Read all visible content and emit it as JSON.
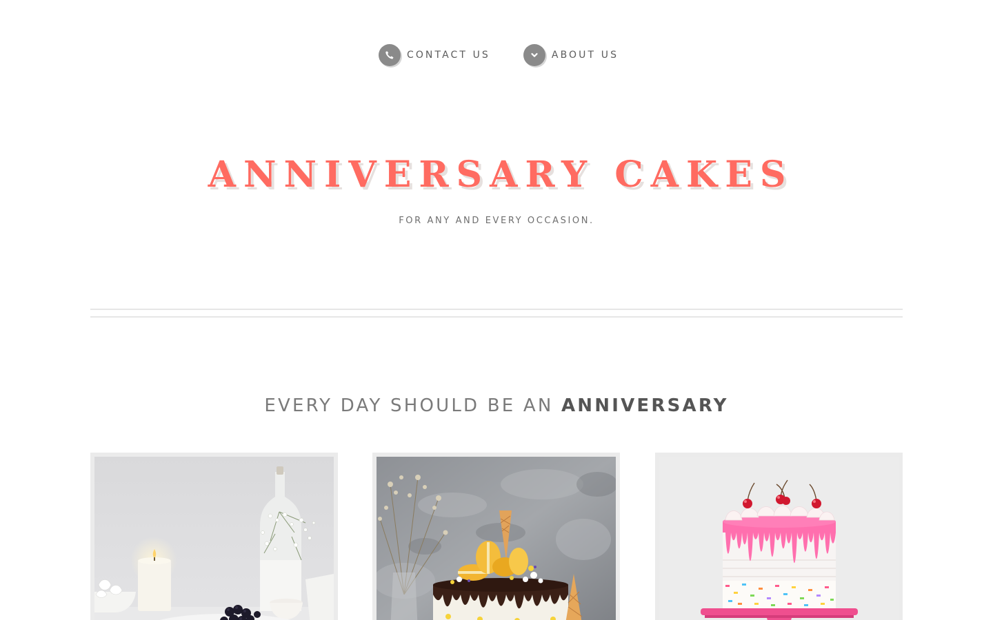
{
  "nav": {
    "items": [
      {
        "label": "CONTACT US",
        "icon": "phone-icon"
      },
      {
        "label": "ABOUT US",
        "icon": "chevron-down-icon"
      }
    ],
    "icon_bg_color": "#8a8a8a"
  },
  "hero": {
    "title": "ANNIVERSARY CAKES",
    "subtitle": "FOR ANY AND EVERY OCCASION.",
    "title_color": "#ff6b61"
  },
  "section": {
    "heading_light": "EVERY DAY SHOULD BE AN ",
    "heading_bold": "ANNIVERSARY"
  },
  "cards": [
    {
      "image": "cake-photo-candle-and-blackberries"
    },
    {
      "image": "cake-photo-chocolate-drip-with-macarons"
    },
    {
      "image": "cake-photo-pink-drip-with-cherries"
    }
  ]
}
